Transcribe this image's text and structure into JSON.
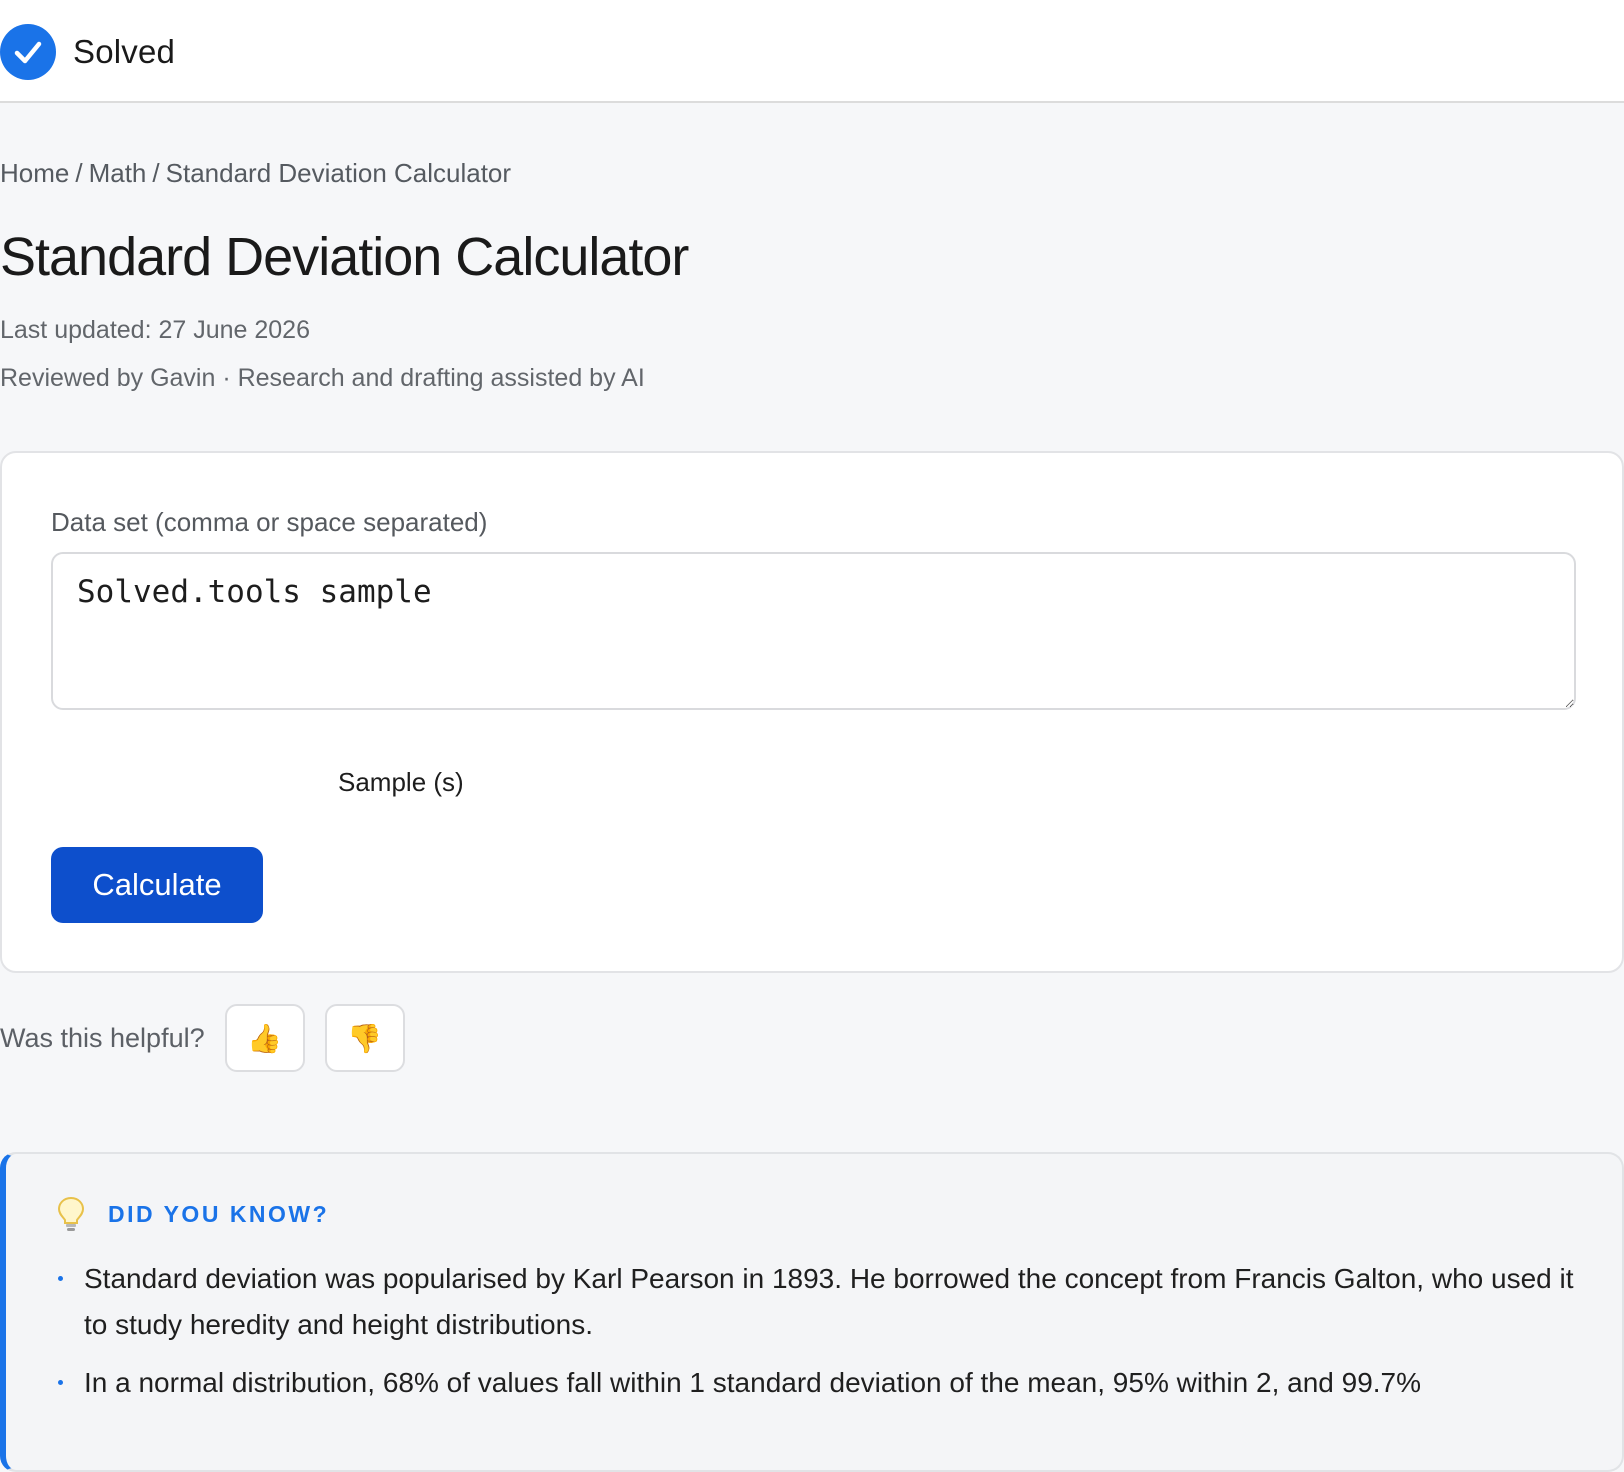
{
  "header": {
    "brand_name": "Solved",
    "brand_icon": "check-circle-icon",
    "brand_color": "#1a73e8"
  },
  "breadcrumb": {
    "items": [
      "Home",
      "Math",
      "Standard Deviation Calculator"
    ],
    "separator": "/"
  },
  "page": {
    "title": "Standard Deviation Calculator",
    "last_updated": "Last updated: 27 June 2026",
    "reviewed": "Reviewed by Gavin · Research and drafting assisted by AI"
  },
  "calculator": {
    "field_label": "Data set (comma or space separated)",
    "input_value": "Solved.tools sample",
    "mode_option": "Sample (s)",
    "calculate_label": "Calculate",
    "button_color": "#0d4fcc"
  },
  "feedback": {
    "question": "Was this helpful?",
    "up_icon": "thumbs-up-icon",
    "down_icon": "thumbs-down-icon",
    "up_glyph": "👍",
    "down_glyph": "👎"
  },
  "did_you_know": {
    "icon": "lightbulb-icon",
    "title": "DID YOU KNOW?",
    "accent": "#1a73e8",
    "items": [
      "Standard deviation was popularised by Karl Pearson in 1893. He borrowed the concept from Francis Galton, who used it to study heredity and height distributions.",
      "In a normal distribution, 68% of values fall within 1 standard deviation of the mean, 95% within 2, and 99.7%"
    ]
  }
}
